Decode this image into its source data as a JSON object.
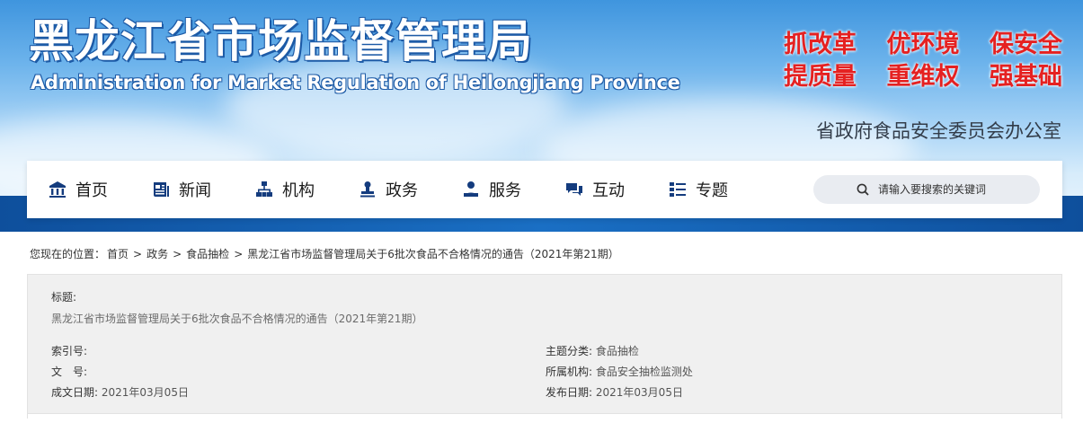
{
  "header": {
    "logo_cn": "黑龙江省市场监督管理局",
    "logo_en": "Administration for Market Regulation of Heilongjiang Province",
    "slogans": [
      [
        "抓改革",
        "优环境",
        "保安全"
      ],
      [
        "提质量",
        "重维权",
        "强基础"
      ]
    ],
    "office": "省政府食品安全委员会办公室",
    "slogan_color": "#e52121"
  },
  "nav": {
    "items": [
      {
        "label": "首页",
        "icon": "bank-icon"
      },
      {
        "label": "新闻",
        "icon": "newspaper-icon"
      },
      {
        "label": "机构",
        "icon": "org-chart-icon"
      },
      {
        "label": "政务",
        "icon": "stamp-icon"
      },
      {
        "label": "服务",
        "icon": "user-service-icon"
      },
      {
        "label": "互动",
        "icon": "chat-icon"
      },
      {
        "label": "专题",
        "icon": "list-icon"
      }
    ],
    "icon_color": "#143c7e",
    "search_placeholder": "请输入要搜索的关键词"
  },
  "breadcrumb": {
    "prefix": "您现在的位置：",
    "items": [
      "首页",
      "政务",
      "食品抽检",
      "黑龙江省市场监督管理局关于6批次食品不合格情况的通告（2021年第21期）"
    ],
    "separator": ">"
  },
  "meta": {
    "title_label": "标题:",
    "title_value": "黑龙江省市场监督管理局关于6批次食品不合格情况的通告（2021年第21期）",
    "index_label": "索引号:",
    "index_value": "",
    "docno_label": "文　号:",
    "docno_value": "",
    "created_label": "成文日期:",
    "created_value": "2021年03月05日",
    "category_label": "主题分类:",
    "category_value": "食品抽检",
    "org_label": "所属机构:",
    "org_value": "食品安全抽检监测处",
    "published_label": "发布日期:",
    "published_value": "2021年03月05日"
  }
}
